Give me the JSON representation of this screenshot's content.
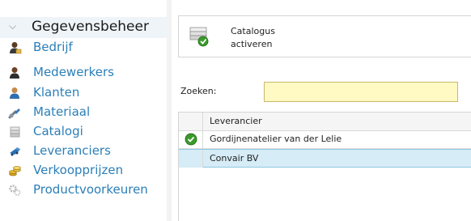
{
  "sidebar": {
    "section_title": "Gegevensbeheer",
    "items": [
      {
        "label": "Bedrijf",
        "icon": "person-icon"
      },
      {
        "label": "Medewerkers",
        "icon": "person-icon"
      },
      {
        "label": "Klanten",
        "icon": "person-icon"
      },
      {
        "label": "Materiaal",
        "icon": "tools-icon"
      },
      {
        "label": "Catalogi",
        "icon": "catalog-icon"
      },
      {
        "label": "Leveranciers",
        "icon": "truck-icon"
      },
      {
        "label": "Verkoopprijzen",
        "icon": "coins-icon"
      },
      {
        "label": "Productvoorkeuren",
        "icon": "gear-icon"
      }
    ]
  },
  "toolbar": {
    "activate_line1": "Catalogus",
    "activate_line2": "activeren"
  },
  "search": {
    "label": "Zoeken:",
    "value": ""
  },
  "table": {
    "column_header": "Leverancier",
    "rows": [
      {
        "name": "Gordijnenatelier van der Lelie",
        "active": true,
        "selected": false
      },
      {
        "name": "Convair BV",
        "active": false,
        "selected": true
      }
    ]
  },
  "colors": {
    "link": "#2b7fb8",
    "search_bg": "#fff9c4",
    "selected_row": "#d6ecf6",
    "check_green": "#3a9a2a"
  }
}
